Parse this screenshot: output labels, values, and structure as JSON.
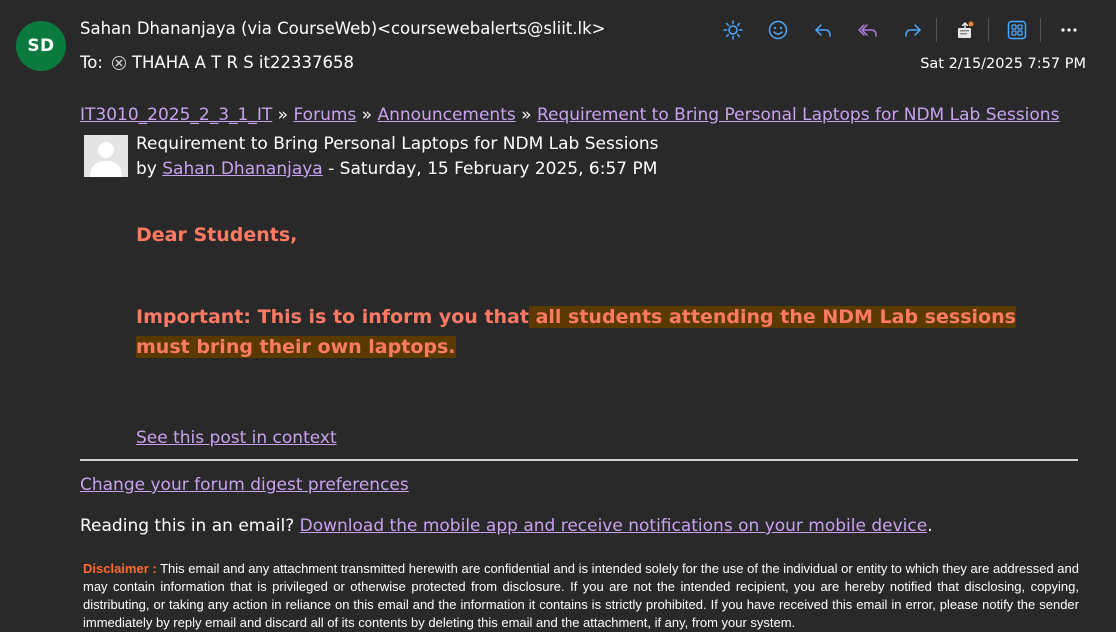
{
  "colors": {
    "background": "#292929",
    "avatar_bg": "#0b7a3e",
    "link": "#c8a2f0",
    "accent_text": "#ff7a62",
    "highlight": "#5a3a00",
    "disclaimer_label": "#ff6a2c",
    "toolbar_icon": "#4aa8ff"
  },
  "header": {
    "avatar_initials": "SD",
    "from": "Sahan Dhananjaya (via CourseWeb)<coursewebalerts@sliit.lk>",
    "to_label": "To:",
    "to_recipient": "THAHA A T R S it22337658",
    "date": "Sat 2/15/2025 7:57 PM",
    "toolbar": [
      {
        "icon": "sun-icon"
      },
      {
        "icon": "smiley-icon"
      },
      {
        "icon": "reply-icon"
      },
      {
        "icon": "reply-all-icon"
      },
      {
        "icon": "forward-icon"
      },
      {
        "icon": "teams-share-icon"
      },
      {
        "icon": "apps-icon"
      },
      {
        "icon": "more-icon"
      }
    ]
  },
  "breadcrumb": {
    "course": "IT3010_2025_2_3_1_IT",
    "sep": " » ",
    "forums": "Forums",
    "announcements": "Announcements",
    "post": "Requirement to Bring Personal Laptops for NDM Lab Sessions"
  },
  "post": {
    "title": "Requirement to Bring Personal Laptops for NDM Lab Sessions",
    "by_prefix": "by ",
    "author": "Sahan Dhananjaya",
    "date_suffix": " - Saturday, 15 February 2025, 6:57 PM",
    "greeting": "Dear Students,",
    "important_plain": "Important: This is to inform you that",
    "important_highlight": " all students attending the NDM Lab sessions must bring their own laptops.",
    "see_post": "See this post in context"
  },
  "footer": {
    "digest_link": "Change your forum digest preferences",
    "reading_prefix": "Reading this in an email? ",
    "reading_link": "Download the mobile app and receive notifications on your mobile device",
    "reading_suffix": ".",
    "disclaimer_label": "Disclaimer :",
    "disclaimer_text": " This email and any attachment transmitted herewith are confidential and is intended solely for the use of the individual or entity to which they are addressed and may contain information that is privileged or otherwise protected from disclosure. If you are not the intended recipient, you are hereby notified that disclosing, copying, distributing, or taking any action in reliance on this email and the information it contains is strictly prohibited. If you have received this email in error, please notify the sender immediately by reply email and discard all of its contents by deleting this email and the attachment, if any, from your system."
  }
}
